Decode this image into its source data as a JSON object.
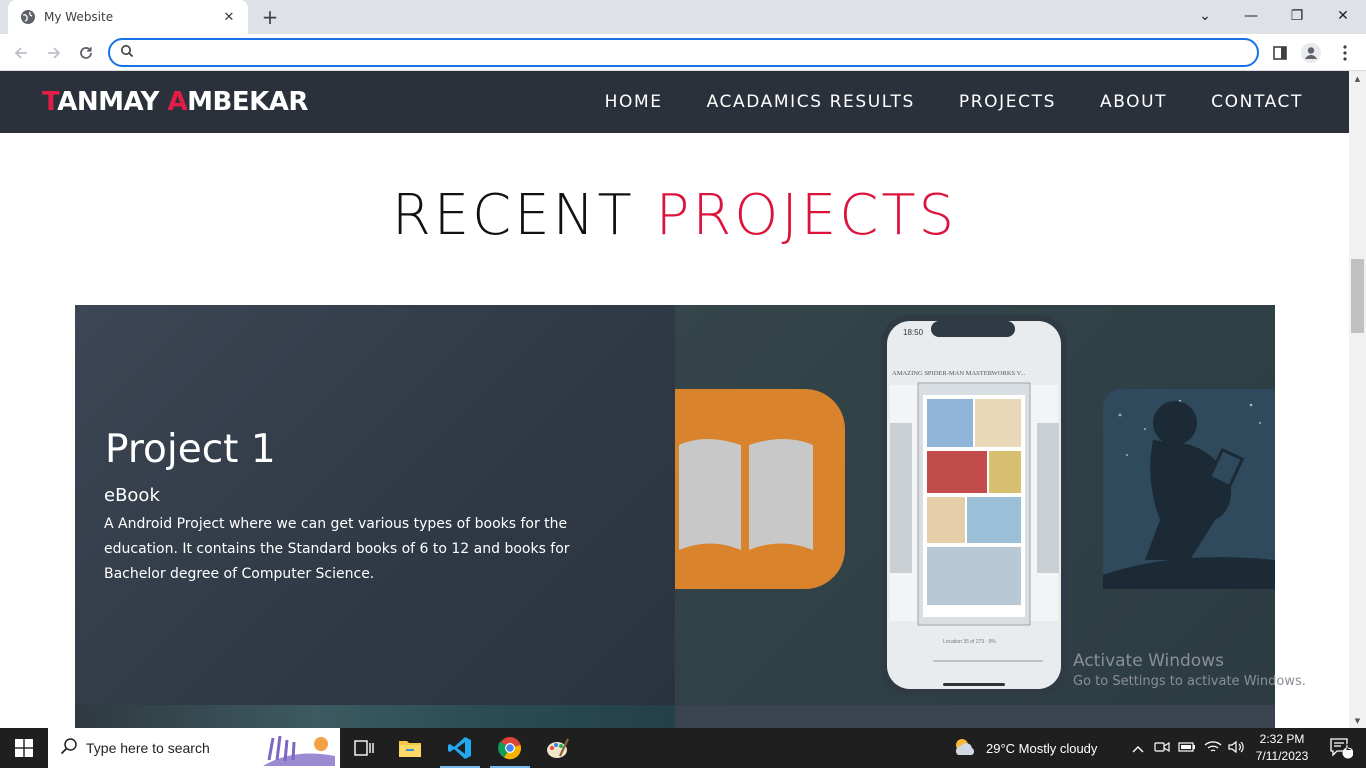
{
  "browser": {
    "tab_title": "My Website",
    "tab_close": "✕",
    "new_tab": "+",
    "address_value": "",
    "window_controls": {
      "dropdown": "⌄",
      "minimize": "—",
      "restore": "❐",
      "close": "✕"
    }
  },
  "site": {
    "brand_first_initial": "T",
    "brand_first_rest": "ANMAY ",
    "brand_last_initial": "A",
    "brand_last_rest": "MBEKAR",
    "nav": [
      "HOME",
      "ACADAMICS RESULTS",
      "PROJECTS",
      "ABOUT",
      "CONTACT"
    ],
    "section_title_plain": "RECENT ",
    "section_title_accent": "PROJECTS",
    "accent_color": "#e11d48",
    "project": {
      "title": "Project 1",
      "subtitle": "eBook",
      "description": "A Android Project where we can get various types of books for the education. It contains the Standard books of 6 to 12 and books for Bachelor degree of Computer Science.",
      "phone_time": "18:50",
      "phone_book_title": "AMAZING SPIDER-MAN MASTERWORKS V...",
      "phone_location": "Location 35 of 273 · 9%"
    }
  },
  "watermark": {
    "line1": "Activate Windows",
    "line2": "Go to Settings to activate Windows."
  },
  "taskbar": {
    "search_placeholder": "Type here to search",
    "weather": "29°C  Mostly cloudy",
    "time": "2:32 PM",
    "date": "7/11/2023",
    "notification_count": "2"
  }
}
